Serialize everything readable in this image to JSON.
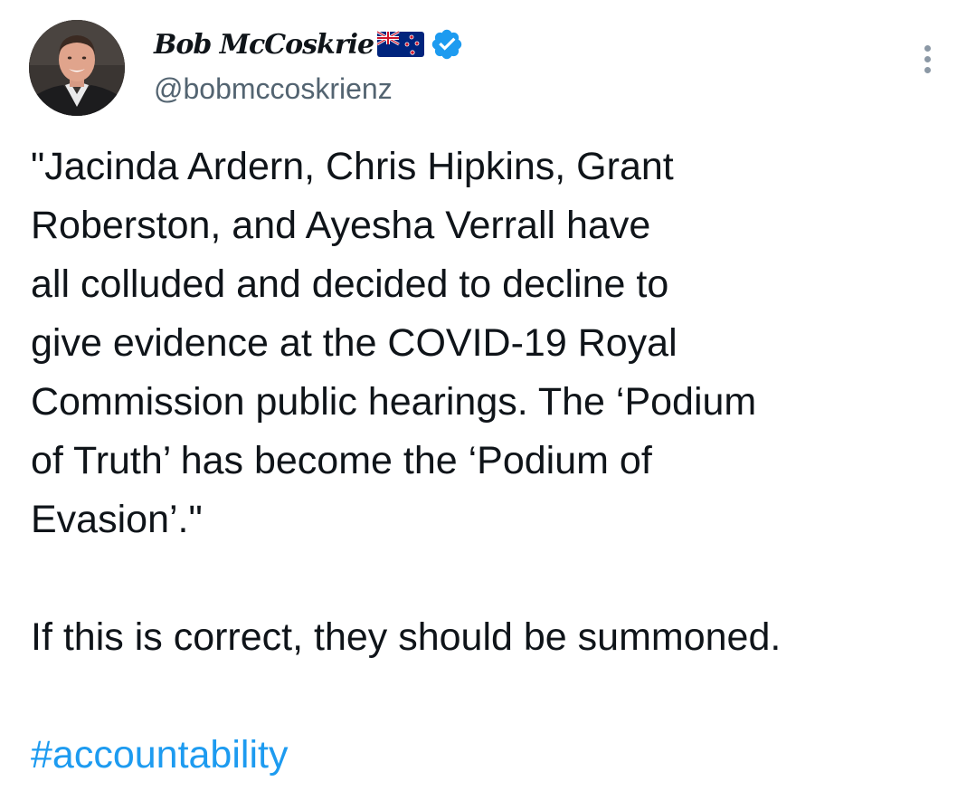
{
  "author": {
    "display_name": "Bob McCoskrie",
    "handle": "@bobmccoskrienz",
    "flag_icon": "new-zealand-flag-icon",
    "verified_icon": "verified-badge-icon",
    "verified_color": "#1d9bf0"
  },
  "more_button_icon": "more-options-icon",
  "tweet": {
    "quote_lines": [
      "\"Jacinda Ardern, Chris Hipkins, Grant",
      "Roberston, and Ayesha Verrall have",
      "all colluded and decided to decline to",
      "give evidence at the COVID-19 Royal",
      "Commission public hearings. The ‘Podium",
      "of Truth’ has become the ‘Podium of",
      "Evasion’.\""
    ],
    "comment": "If this is correct, they should be summoned.",
    "hashtag": "#accountability",
    "hashtag_color": "#1d9bf0"
  }
}
